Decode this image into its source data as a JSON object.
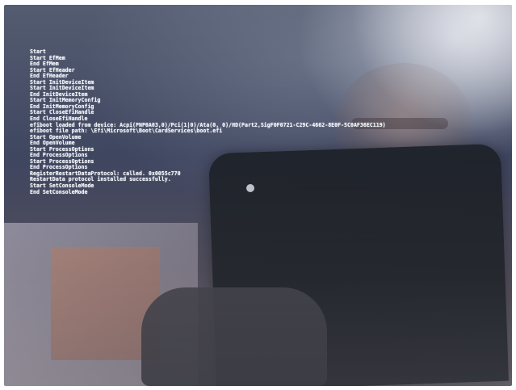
{
  "boot_log": {
    "lines": [
      "Start",
      "Start EfMem",
      "End EfMem",
      "Start EfHeader",
      "End EfHeader",
      "Start InitDeviceItem",
      "Start InitDeviceItem",
      "End InitDeviceItem",
      "Start InitMemoryConfig",
      "End InitMemoryConfig",
      "Start CloseEfiHandle",
      "End CloseEfiHandle",
      "efiboot loaded from device: Acpi(PNP0A03,0)/Pci(1|0)/Ata(0, 0)/HD(Part2,SigF0F0721-C29C-4662-8E0F-5C0AF36EC119)",
      "efiboot file path: \\Efi\\Microsoft\\Boot\\CardServices\\boot.efi",
      "Start OpenVolume",
      "End OpenVolume",
      "Start ProcessOptions",
      "End ProcessOptions",
      "Start ProcessOptions",
      "End ProcessOptions",
      "RegisterRestartDataProtocol: called. 0x0055c770",
      "RestartData protocol installed successfully.",
      "Start SetConsoleMode",
      "End SetConsoleMode"
    ]
  }
}
